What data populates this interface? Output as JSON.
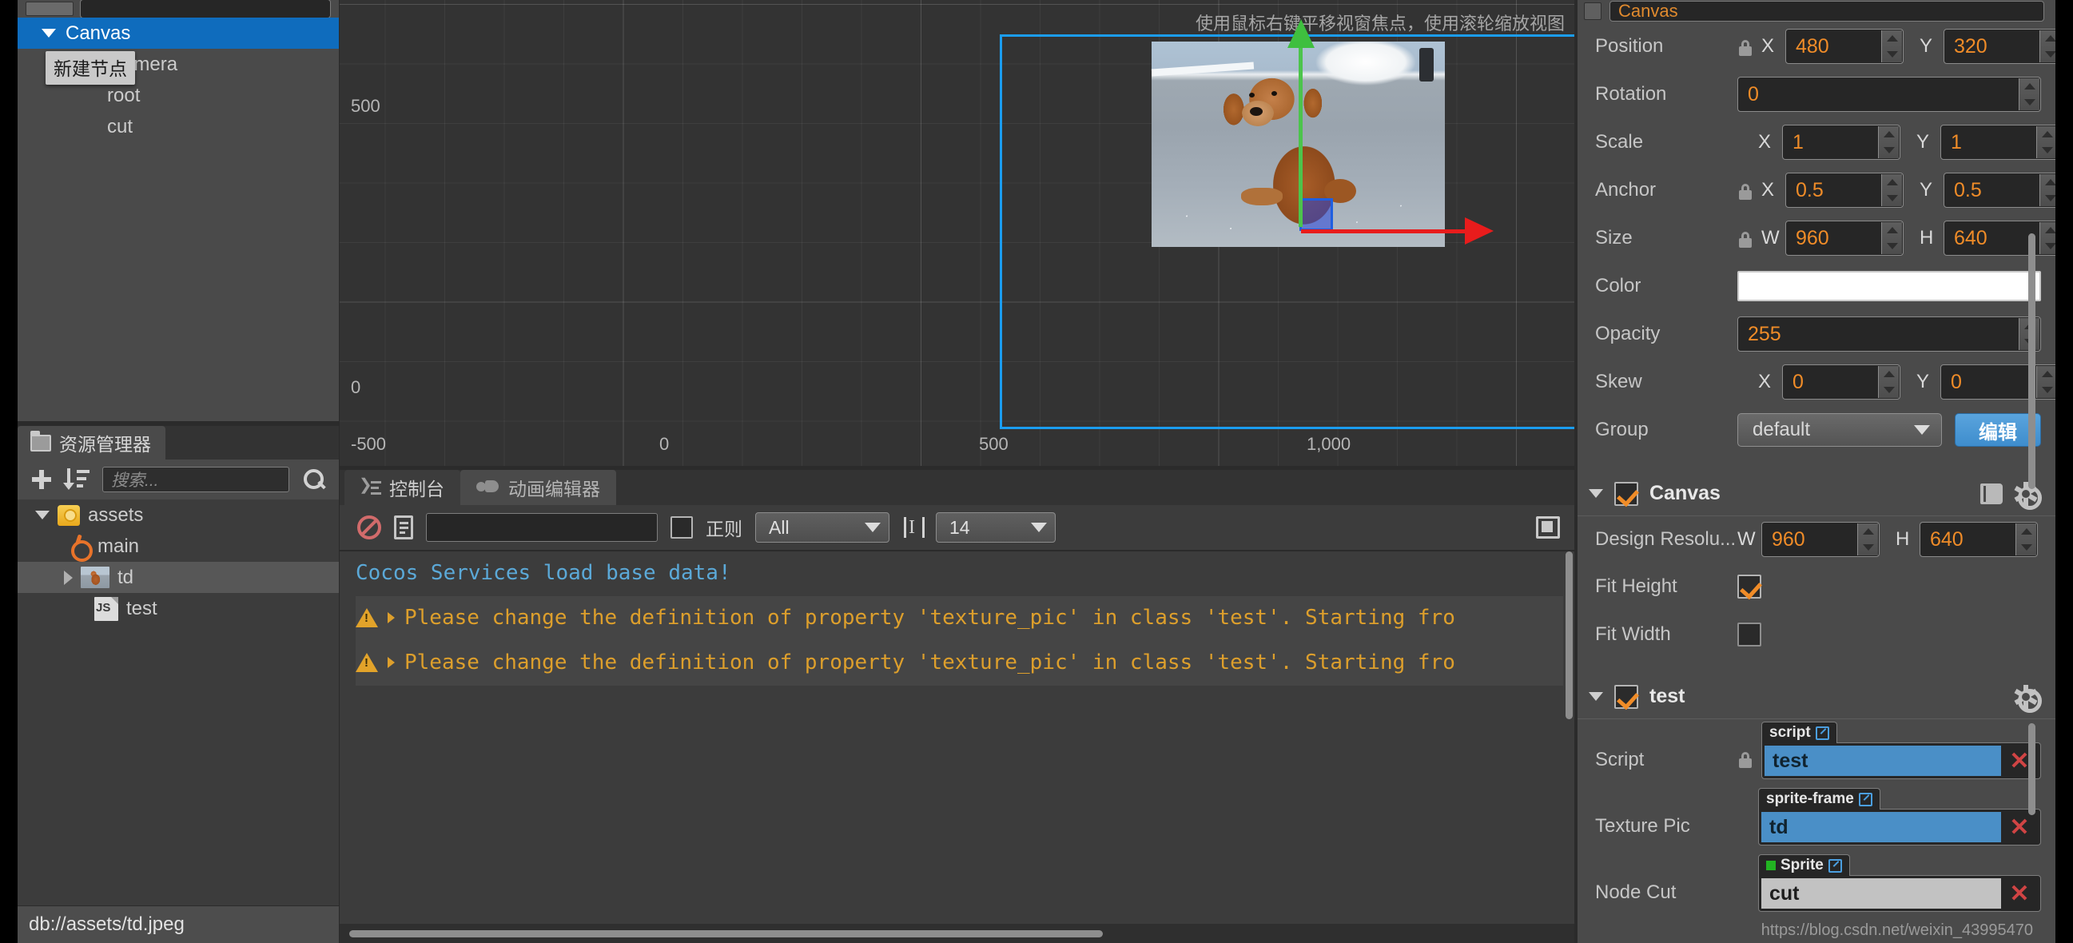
{
  "hierarchy": {
    "panel_name": "hierarchy",
    "tooltip": "新建节点",
    "nodes": [
      {
        "label": "Canvas",
        "depth": 0,
        "expanded": true,
        "selected": true
      },
      {
        "label": "Main Camera",
        "depth": 1,
        "expanded": false,
        "selected": false
      },
      {
        "label": "root",
        "depth": 1,
        "expanded": false,
        "selected": false
      },
      {
        "label": "cut",
        "depth": 1,
        "expanded": false,
        "selected": false
      }
    ]
  },
  "assets": {
    "tab_label": "资源管理器",
    "search_placeholder": "搜索...",
    "add_icon": "plus-icon",
    "sort_icon": "sort-icon",
    "search_icon": "search-icon",
    "tree": [
      {
        "label": "assets",
        "depth": 0,
        "icon": "folder-icon",
        "expanded": true,
        "selected": false
      },
      {
        "label": "main",
        "depth": 1,
        "icon": "scene-fire-icon",
        "expanded": false,
        "selected": false
      },
      {
        "label": "td",
        "depth": 1,
        "icon": "image-thumbnail-icon",
        "expanded": false,
        "selected": true
      },
      {
        "label": "test",
        "depth": 1,
        "icon": "javascript-file-icon",
        "expanded": false,
        "selected": false
      }
    ],
    "status_path": "db://assets/td.jpeg"
  },
  "scene": {
    "hint": "使用鼠标右键平移视窗焦点，使用滚轮缩放视图",
    "ruler_labels": {
      "y_top": "500",
      "y_zero": "0",
      "y_bottom": "-500",
      "x_zero": "0",
      "x_mid": "500",
      "x_right": "1,000"
    },
    "gizmo": {
      "y_axis_color": "#4cc44c",
      "x_axis_color": "#e81c1c",
      "handle_color": "#1f5fe0"
    },
    "canvas_border_color": "#1b9df0"
  },
  "console": {
    "tabs": [
      {
        "label": "控制台",
        "icon": "console-icon",
        "active": true
      },
      {
        "label": "动画编辑器",
        "icon": "animation-icon",
        "active": false
      }
    ],
    "toolbar": {
      "clear_icon": "ban-clear-icon",
      "file_icon": "document-icon",
      "filter_value": "",
      "regex_checkbox_label": "正则",
      "regex_checked": false,
      "level_select": "All",
      "fontsize_icon": "font-size-icon",
      "fontsize_select": "14",
      "expand_icon": "expand-panel-icon"
    },
    "logs": [
      {
        "type": "info",
        "text": "Cocos Services load base data!"
      },
      {
        "type": "warn",
        "text": "Please change the definition of property 'texture_pic' in class 'test'. Starting fro"
      },
      {
        "type": "warn",
        "text": "Please change the definition of property 'texture_pic' in class 'test'. Starting fro"
      }
    ]
  },
  "inspector": {
    "node_name": "Canvas",
    "node_enabled": true,
    "properties": [
      {
        "name": "Position",
        "label": "Position",
        "lock": true,
        "fields": [
          {
            "axis": "X",
            "value": "480"
          },
          {
            "axis": "Y",
            "value": "320"
          }
        ]
      },
      {
        "name": "Rotation",
        "label": "Rotation",
        "lock": false,
        "fields": [
          {
            "axis": "",
            "value": "0"
          }
        ]
      },
      {
        "name": "Scale",
        "label": "Scale",
        "lock": false,
        "fields": [
          {
            "axis": "X",
            "value": "1"
          },
          {
            "axis": "Y",
            "value": "1"
          }
        ]
      },
      {
        "name": "Anchor",
        "label": "Anchor",
        "lock": true,
        "fields": [
          {
            "axis": "X",
            "value": "0.5"
          },
          {
            "axis": "Y",
            "value": "0.5"
          }
        ]
      },
      {
        "name": "Size",
        "label": "Size",
        "lock": true,
        "fields": [
          {
            "axis": "W",
            "value": "960"
          },
          {
            "axis": "H",
            "value": "640"
          }
        ]
      },
      {
        "name": "Opacity",
        "label": "Opacity",
        "lock": false,
        "fields": [
          {
            "axis": "",
            "value": "255"
          }
        ]
      },
      {
        "name": "Skew",
        "label": "Skew",
        "lock": false,
        "fields": [
          {
            "axis": "X",
            "value": "0"
          },
          {
            "axis": "Y",
            "value": "0"
          }
        ]
      }
    ],
    "color": {
      "label": "Color",
      "value": "#ffffff"
    },
    "group": {
      "label": "Group",
      "value": "default",
      "button_label": "编辑"
    },
    "canvas_component": {
      "title": "Canvas",
      "enabled": true,
      "design_label": "Design Resolu...",
      "design_w": "960",
      "design_h": "640",
      "w_axis": "W",
      "h_axis": "H",
      "fit_height_label": "Fit Height",
      "fit_height": true,
      "fit_width_label": "Fit Width",
      "fit_width": false
    },
    "test_component": {
      "title": "test",
      "enabled": true,
      "refs": [
        {
          "label": "Script",
          "lock": true,
          "tag": "script",
          "value": "test",
          "style": "blue",
          "tag_dot": false
        },
        {
          "label": "Texture Pic",
          "lock": false,
          "tag": "sprite-frame",
          "value": "td",
          "style": "blue",
          "tag_dot": false
        },
        {
          "label": "Node Cut",
          "lock": false,
          "tag": "Sprite",
          "value": "cut",
          "style": "grey",
          "tag_dot": true
        }
      ]
    },
    "watermark": "https://blog.csdn.net/weixin_43995470"
  }
}
